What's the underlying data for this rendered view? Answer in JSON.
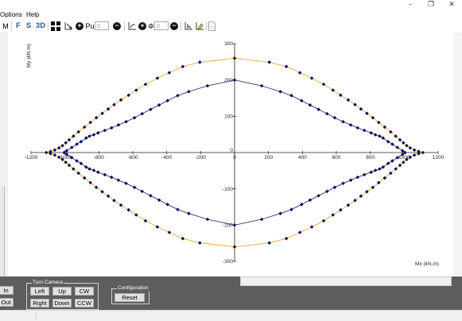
{
  "window": {
    "minimize_glyph": "–",
    "maximize_glyph": "❐",
    "close_glyph": "✕"
  },
  "menu": {
    "items": [
      "Options",
      "Help"
    ]
  },
  "toolbar": {
    "m_label": "M",
    "f_label": "F",
    "s_label": "S",
    "d3_label": "3D",
    "pu_label": "Pu",
    "pu_value": "0",
    "phi_label": "Φ",
    "phi_value": "0",
    "plus_glyph": "+",
    "minus_glyph": "−"
  },
  "bottom": {
    "zoom_in": "In",
    "zoom_out": "Out",
    "camera_title": "Turn Camera",
    "left": "Left",
    "up": "Up",
    "cw": "CW",
    "right": "Right",
    "down": "Down",
    "ccw": "CCW",
    "config_title": "Configuration",
    "reset": "Reset"
  },
  "chart_data": {
    "type": "scatter",
    "xlabel": "Mx (kN.m)",
    "ylabel": "My (kN.m)",
    "xlim": [
      -1200,
      1200
    ],
    "ylim": [
      -300,
      300
    ],
    "xticks": [
      -1200,
      -1000,
      -800,
      -600,
      -400,
      -200,
      0,
      200,
      400,
      600,
      800,
      1000,
      1200
    ],
    "yticks": [
      -300,
      -200,
      -100,
      0,
      100,
      200,
      300
    ],
    "series": [
      {
        "color": "#f5a623",
        "points": [
          [
            0,
            260
          ],
          [
            205,
            249
          ],
          [
            305,
            237
          ],
          [
            385,
            220
          ],
          [
            455,
            205
          ],
          [
            525,
            188
          ],
          [
            580,
            172
          ],
          [
            625,
            158
          ],
          [
            670,
            145
          ],
          [
            710,
            132
          ],
          [
            745,
            120
          ],
          [
            780,
            108
          ],
          [
            815,
            96
          ],
          [
            850,
            83
          ],
          [
            885,
            70
          ],
          [
            920,
            57
          ],
          [
            950,
            45
          ],
          [
            975,
            35
          ],
          [
            995,
            27
          ],
          [
            1015,
            19
          ],
          [
            1035,
            13
          ],
          [
            1060,
            7
          ],
          [
            1085,
            3
          ],
          [
            1110,
            0
          ]
        ]
      },
      {
        "color": "#2c3a7a",
        "points": [
          [
            0,
            200
          ],
          [
            160,
            184
          ],
          [
            270,
            168
          ],
          [
            335,
            157
          ],
          [
            395,
            143
          ],
          [
            445,
            131
          ],
          [
            495,
            119
          ],
          [
            545,
            107
          ],
          [
            590,
            96
          ],
          [
            640,
            85
          ],
          [
            685,
            76
          ],
          [
            725,
            68
          ],
          [
            765,
            61
          ],
          [
            805,
            54
          ],
          [
            830,
            49
          ],
          [
            855,
            45
          ],
          [
            875,
            40
          ],
          [
            905,
            30
          ],
          [
            930,
            23
          ],
          [
            960,
            14
          ],
          [
            990,
            5
          ],
          [
            1005,
            0
          ]
        ]
      }
    ]
  }
}
